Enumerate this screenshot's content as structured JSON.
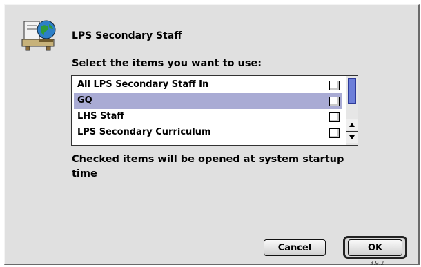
{
  "dialog": {
    "title": "LPS Secondary Staff",
    "prompt": "Select the items you want to use:",
    "note": "Checked items will be opened at system startup time",
    "icon": "network-globe-icon",
    "version": "3.9.2"
  },
  "list": {
    "items": [
      {
        "label": "All LPS Secondary Staff In",
        "checked": false,
        "selected": false
      },
      {
        "label": "GQ",
        "checked": false,
        "selected": true
      },
      {
        "label": "LHS Staff",
        "checked": false,
        "selected": false
      },
      {
        "label": "LPS Secondary Curriculum",
        "checked": false,
        "selected": false
      }
    ]
  },
  "buttons": {
    "cancel": "Cancel",
    "ok": "OK"
  },
  "colors": {
    "selection": "#a9abd4",
    "scroll_thumb": "#6d7fd9",
    "dialog_bg": "#e0e0e0"
  }
}
